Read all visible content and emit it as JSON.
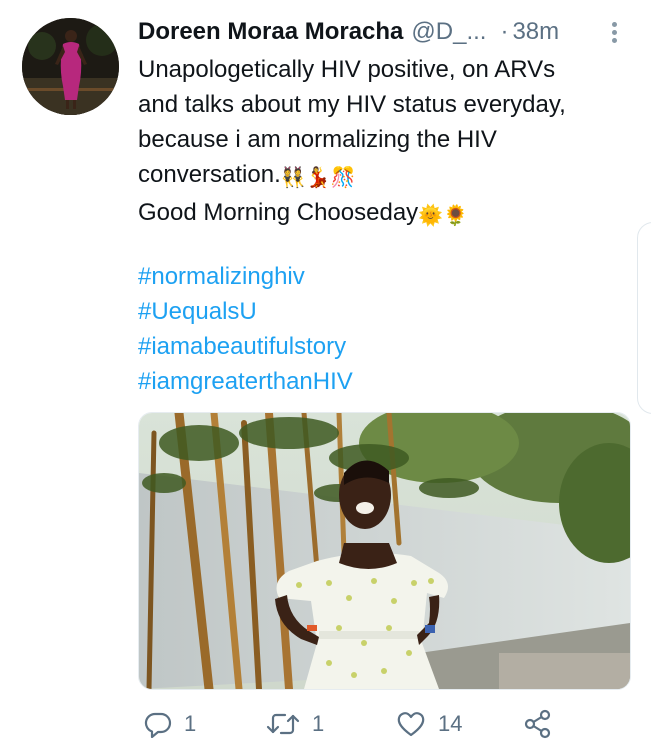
{
  "tweet": {
    "author_name": "Doreen Moraa Moracha",
    "handle": "@D_...",
    "separator": "·",
    "time": "38m",
    "text_lines": [
      "Unapologetically HIV positive, on ARVs",
      "and talks about my HIV status everyday,",
      "because i am normalizing the HIV",
      "conversation."
    ],
    "line4_emojis": "👯💃🎊",
    "greeting": "Good Morning Chooseday",
    "greeting_emojis": "🌞🌻",
    "hashtags": [
      "#normalizinghiv",
      "#UequalsU",
      "#iamabeautifulstory",
      "#iamgreaterthanHIV"
    ]
  },
  "actions": {
    "reply_count": "1",
    "retweet_count": "1",
    "like_count": "14",
    "icons": {
      "reply": "reply-icon",
      "retweet": "retweet-icon",
      "like": "heart-icon",
      "share": "share-icon",
      "more": "more-vertical-icon"
    }
  },
  "colors": {
    "link": "#1da1f2",
    "muted": "#5b7083",
    "text": "#0f1419"
  }
}
